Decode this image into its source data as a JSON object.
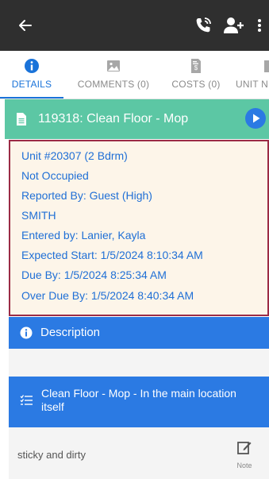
{
  "colors": {
    "appbar_bg": "#2f2f2f",
    "accent_blue": "#2b7ae3",
    "tab_active": "#1a73d9",
    "header_green": "#5cc7a4",
    "details_border": "#9b2b45",
    "details_bg": "#fdf5e9",
    "details_text": "#1f6fd6"
  },
  "appbar": {
    "back_icon": "arrow-left-icon",
    "icons": [
      "phone-icon",
      "add-user-icon",
      "more-vertical-icon"
    ]
  },
  "tabs": [
    {
      "label": "DETAILS",
      "icon": "info-icon",
      "active": true
    },
    {
      "label": "COMMENTS (0)",
      "icon": "image-icon",
      "active": false
    },
    {
      "label": "COSTS (0)",
      "icon": "invoice-icon",
      "active": false
    },
    {
      "label": "UNIT N",
      "icon": "unit-icon",
      "active": false
    }
  ],
  "work_order": {
    "title": "119318: Clean Floor - Mop"
  },
  "details": {
    "unit": "Unit #20307 (2 Bdrm)",
    "occupancy": "Not Occupied",
    "reported_by": "Reported By: Guest  (High)",
    "reporter_name": "SMITH",
    "entered_by": "Entered by: Lanier, Kayla",
    "expected_start": "Expected Start: 1/5/2024 8:10:34 AM",
    "due_by": "Due By: 1/5/2024 8:25:34 AM",
    "over_due_by": "Over Due By: 1/5/2024 8:40:34 AM"
  },
  "description": {
    "label": "Description"
  },
  "task": {
    "label": "Clean Floor - Mop - In the main location itself"
  },
  "note": {
    "text": "sticky and dirty",
    "button_label": "Note"
  }
}
